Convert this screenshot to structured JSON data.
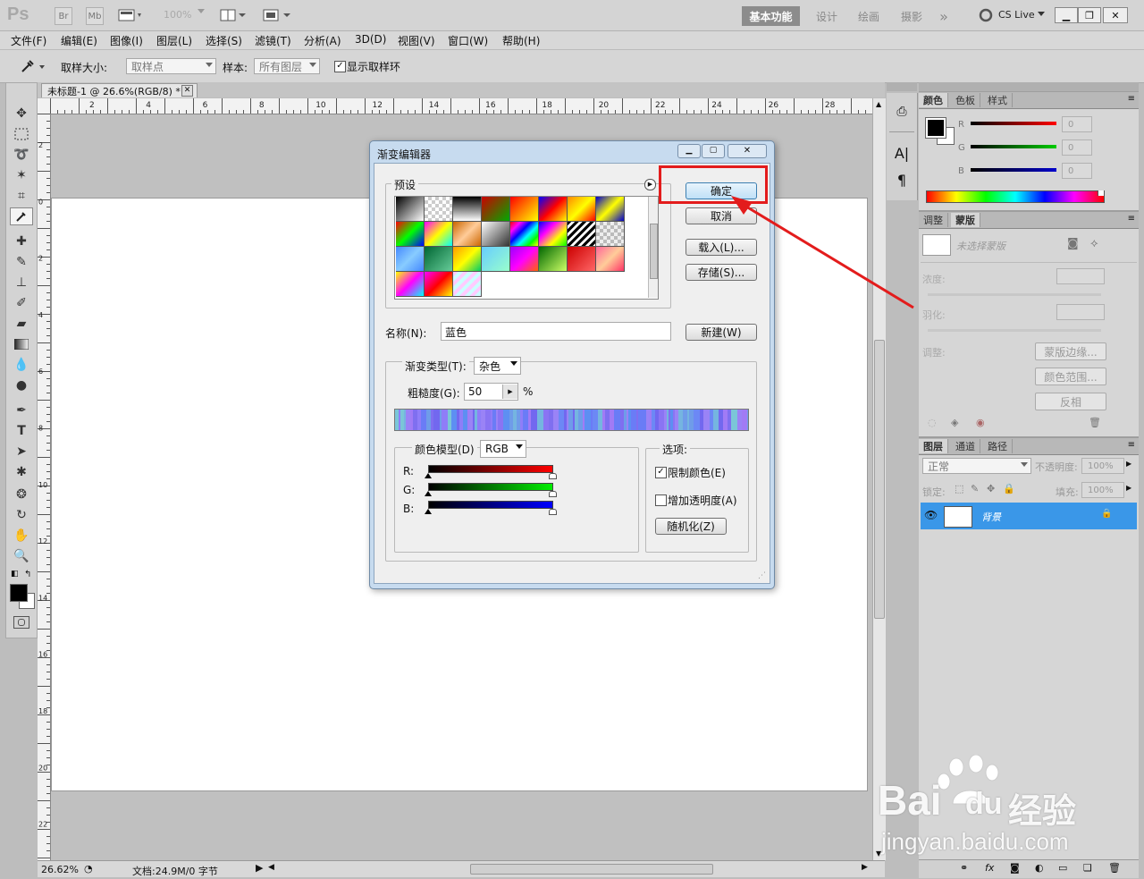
{
  "appbar": {
    "logo": "Ps",
    "bridge": "Br",
    "minibridge": "Mb",
    "zoom": "100%",
    "workspaces": [
      "基本功能",
      "设计",
      "绘画",
      "摄影"
    ],
    "more": "»",
    "cslive": "CS Live"
  },
  "menu": [
    "文件(F)",
    "编辑(E)",
    "图像(I)",
    "图层(L)",
    "选择(S)",
    "滤镜(T)",
    "分析(A)",
    "3D(D)",
    "视图(V)",
    "窗口(W)",
    "帮助(H)"
  ],
  "options": {
    "sample_size_label": "取样大小:",
    "sample_size_value": "取样点",
    "sample_label": "样本:",
    "sample_value": "所有图层",
    "show_ring_label": "显示取样环",
    "show_ring_checked": true
  },
  "document": {
    "tab_title": "未标题-1 @ 26.6%(RGB/8) *",
    "ruler_top": [
      "2",
      "4",
      "6",
      "8",
      "10",
      "12",
      "14",
      "16",
      "18",
      "20",
      "22",
      "24",
      "26",
      "28"
    ],
    "ruler_left": [
      "2",
      "0",
      "2",
      "4",
      "6",
      "8",
      "10",
      "12",
      "14",
      "16",
      "18",
      "20",
      "22"
    ],
    "zoom": "26.62%",
    "doc_info": "文档:24.9M/0 字节"
  },
  "color_panel": {
    "tabs": [
      "颜色",
      "色板",
      "样式"
    ],
    "channels": [
      {
        "label": "R",
        "value": "0"
      },
      {
        "label": "G",
        "value": "0"
      },
      {
        "label": "B",
        "value": "0"
      }
    ]
  },
  "masks_panel": {
    "tabs": [
      "调整",
      "蒙版"
    ],
    "no_mask": "未选择蒙版",
    "density": "浓度:",
    "feather": "羽化:",
    "refine": "调整:",
    "btn_edge": "蒙版边缘...",
    "btn_range": "颜色范围...",
    "btn_invert": "反相"
  },
  "layers_panel": {
    "tabs": [
      "图层",
      "通道",
      "路径"
    ],
    "blend_mode": "正常",
    "opacity_label": "不透明度:",
    "opacity": "100%",
    "lock_label": "锁定:",
    "fill_label": "填充:",
    "fill": "100%",
    "layer_name": "背景"
  },
  "dialog": {
    "title": "渐变编辑器",
    "presets_label": "预设",
    "ok": "确定",
    "cancel": "取消",
    "load": "载入(L)...",
    "save": "存储(S)...",
    "name_label": "名称(N):",
    "name_value": "蓝色",
    "new_btn": "新建(W)",
    "type_label": "渐变类型(T):",
    "type_value": "杂色",
    "roughness_label": "粗糙度(G):",
    "roughness_value": "50",
    "percent": "%",
    "color_model_label": "颜色模型(D)",
    "color_model_value": "RGB",
    "channels": [
      "R:",
      "G:",
      "B:"
    ],
    "options_label": "选项:",
    "restrict_label": "限制颜色(E)",
    "restrict_checked": true,
    "add_transparency_label": "增加透明度(A)",
    "add_transparency_checked": false,
    "randomize": "随机化(Z)"
  },
  "watermark": {
    "text1": "Bai",
    "text2": "du",
    "text3": "经验",
    "url": "jingyan.baidu.com"
  },
  "colors": {
    "annotation_red": "#e31c1c",
    "layer_selected": "#3a97e8"
  }
}
